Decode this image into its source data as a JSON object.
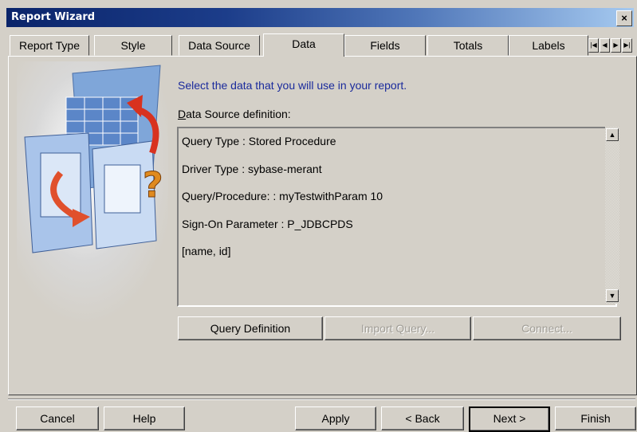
{
  "window": {
    "title": "Report Wizard",
    "close_label": "×"
  },
  "tabs": [
    {
      "label": "Report Type"
    },
    {
      "label": "Style"
    },
    {
      "label": "Data Source"
    },
    {
      "label": "Data",
      "active": true
    },
    {
      "label": "Fields"
    },
    {
      "label": "Totals"
    },
    {
      "label": "Labels"
    }
  ],
  "tab_nav": {
    "first": "|◀",
    "prev": "◀",
    "next": "▶",
    "last": "▶|"
  },
  "main": {
    "instruction": "Select the data that you will use in your report.",
    "datasource_label_accel": "D",
    "datasource_label_rest": "ata Source definition:",
    "definition_lines": [
      "Query Type : Stored Procedure",
      "Driver Type : sybase-merant",
      "Query/Procedure: : myTestwithParam 10",
      "Sign-On Parameter :  P_JDBCPDS",
      "[name, id]"
    ],
    "buttons": {
      "query_definition": "Query Definition",
      "import_query": "Import Query...",
      "connect": "Connect..."
    }
  },
  "footer": {
    "cancel": "Cancel",
    "help": "Help",
    "apply": "Apply",
    "back": "< Back",
    "next": "Next >",
    "finish": "Finish"
  },
  "colors": {
    "titlebar_start": "#0a246a",
    "titlebar_end": "#a6caf0",
    "instruction_text": "#1a2a9c",
    "face": "#d4d0c8"
  }
}
